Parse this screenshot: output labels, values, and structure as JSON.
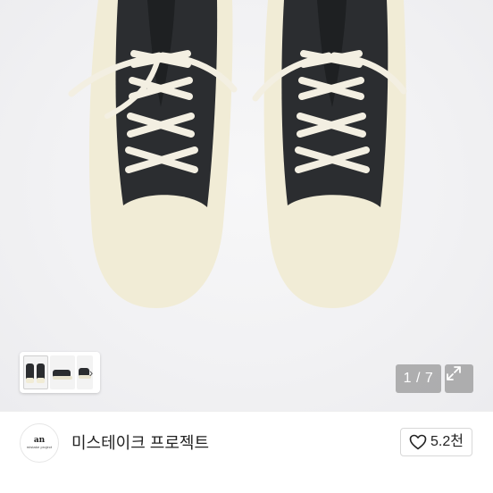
{
  "gallery": {
    "counter": "1 / 7",
    "thumbnails": [
      "sneakers-top-view",
      "sneakers-side-view",
      "sneakers-pair-view"
    ]
  },
  "shop": {
    "avatar_logo": "an",
    "avatar_text": "mistake project",
    "name": "미스테이크 프로젝트",
    "likes": "5.2천"
  },
  "colors": {
    "shoe_upper": "#2b2d30",
    "sole": "#f1ecd6",
    "laces": "#f3efe2",
    "counter_bg": "#8a8a8a"
  }
}
